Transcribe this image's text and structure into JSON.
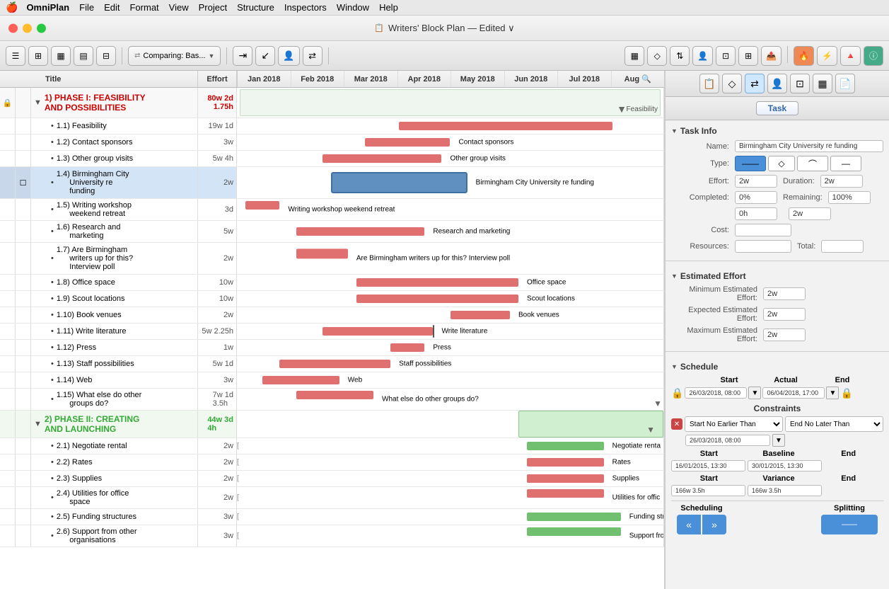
{
  "menubar": {
    "apple": "🍎",
    "items": [
      "OmniPlan",
      "File",
      "Edit",
      "Format",
      "View",
      "Project",
      "Structure",
      "Inspectors",
      "Window",
      "Help"
    ]
  },
  "titlebar": {
    "icon": "📋",
    "title": "Writers' Block Plan — Edited ∨"
  },
  "toolbar": {
    "comparing": "Comparing: Bas...",
    "buttons": [
      "≡",
      "⊞",
      "▦",
      "⊟",
      "≡",
      "↕"
    ]
  },
  "columns": {
    "title": "Title",
    "effort": "Effort",
    "months": [
      "Jan 2018",
      "Feb 2018",
      "Mar 2018",
      "Apr 2018",
      "May 2018",
      "Jun 2018",
      "Jul 2018",
      "Aug 🔍"
    ]
  },
  "tasks": [
    {
      "id": "1",
      "indent": 0,
      "phase": true,
      "label": "1)  PHASE I: FEASIBILITY AND POSSIBILITIES",
      "effort": "80w 2d\n1.75h",
      "effort_color": "red"
    },
    {
      "id": "1.1",
      "indent": 1,
      "label": "1.1)  Feasibility",
      "effort": "19w 1d"
    },
    {
      "id": "1.2",
      "indent": 1,
      "label": "1.2)  Contact sponsors",
      "effort": "3w"
    },
    {
      "id": "1.3",
      "indent": 1,
      "label": "1.3)  Other group visits",
      "effort": "5w 4h"
    },
    {
      "id": "1.4",
      "indent": 1,
      "label": "1.4)  Birmingham City University re funding",
      "effort": "2w",
      "selected": true
    },
    {
      "id": "1.5",
      "indent": 1,
      "label": "1.5)  Writing workshop weekend retreat",
      "effort": "3d"
    },
    {
      "id": "1.6",
      "indent": 1,
      "label": "1.6)  Research and marketing",
      "effort": "5w"
    },
    {
      "id": "1.7",
      "indent": 1,
      "label": "1.7)  Are Birmingham writers up for this? Interview poll",
      "effort": "2w"
    },
    {
      "id": "1.8",
      "indent": 1,
      "label": "1.8)  Office space",
      "effort": "10w"
    },
    {
      "id": "1.9",
      "indent": 1,
      "label": "1.9)  Scout locations",
      "effort": "10w"
    },
    {
      "id": "1.10",
      "indent": 1,
      "label": "1.10)  Book venues",
      "effort": "2w"
    },
    {
      "id": "1.11",
      "indent": 1,
      "label": "1.11)  Write literature",
      "effort": "5w 2.25h"
    },
    {
      "id": "1.12",
      "indent": 1,
      "label": "1.12)  Press",
      "effort": "1w"
    },
    {
      "id": "1.13",
      "indent": 1,
      "label": "1.13)  Staff possibilities",
      "effort": "5w 1d"
    },
    {
      "id": "1.14",
      "indent": 1,
      "label": "1.14)  Web",
      "effort": "3w"
    },
    {
      "id": "1.15",
      "indent": 1,
      "label": "1.15)  What else do other groups do?",
      "effort": "7w 1d\n3.5h"
    },
    {
      "id": "2",
      "indent": 0,
      "phase": true,
      "phase2": true,
      "label": "2)  PHASE II: CREATING AND LAUNCHING",
      "effort": "44w 3d\n4h",
      "effort_color": "green"
    },
    {
      "id": "2.1",
      "indent": 1,
      "label": "2.1)  Negotiate rental",
      "effort": "2w"
    },
    {
      "id": "2.2",
      "indent": 1,
      "label": "2.2)  Rates",
      "effort": "2w"
    },
    {
      "id": "2.3",
      "indent": 1,
      "label": "2.3)  Supplies",
      "effort": "2w"
    },
    {
      "id": "2.4",
      "indent": 1,
      "label": "2.4)  Utilities for office space",
      "effort": "2w"
    },
    {
      "id": "2.5",
      "indent": 1,
      "label": "2.5)  Funding structures",
      "effort": "3w"
    },
    {
      "id": "2.6",
      "indent": 1,
      "label": "2.6)  Support from other organisations",
      "effort": "3w"
    }
  ],
  "gantt_labels": {
    "feasibility": "Feasibility",
    "contact_sponsors": "Contact sponsors",
    "other_group_visits": "Other group visits",
    "bcuf": "Birmingham City University re funding",
    "writing_workshop": "Writing workshop weekend retreat",
    "research": "Research and marketing",
    "birmingham_writers": "Are Birmingham writers up for this? Interview poll",
    "office_space": "Office space",
    "scout": "Scout locations",
    "book_venues": "Book venues",
    "write_lit": "Write literature",
    "press": "Press",
    "staff": "Staff possibilities",
    "web": "Web",
    "what_else": "What else do other groups do?",
    "neg_rental": "Negotiate renta",
    "rates": "Rates",
    "supplies": "Supplies",
    "utilities": "Utilities for offic",
    "funding_str": "Funding stru",
    "support": "Support fror"
  },
  "inspector": {
    "tab_label": "Task",
    "section_task_info": "Task Info",
    "name_label": "Name:",
    "name_value": "Birmingham City University re funding",
    "type_label": "Type:",
    "effort_label": "Effort:",
    "effort_value": "2w",
    "duration_label": "Duration:",
    "duration_value": "2w",
    "completed_label": "Completed:",
    "completed_value": "0%",
    "remaining_label": "Remaining:",
    "remaining_value": "100%",
    "field_0h": "0h",
    "field_2w": "2w",
    "cost_label": "Cost:",
    "resources_label": "Resources:",
    "total_label": "Total:",
    "section_estimated": "Estimated Effort",
    "min_effort_label": "Minimum Estimated Effort:",
    "min_effort_value": "2w",
    "expected_effort_label": "Expected Estimated Effort:",
    "expected_effort_value": "2w",
    "max_effort_label": "Maximum Estimated Effort:",
    "max_effort_value": "2w",
    "section_schedule": "Schedule",
    "col_start": "Start",
    "col_actual": "Actual",
    "col_end": "End",
    "start_date": "26/03/2018, 08:00",
    "actual_date": "06/04/2018, 17:00",
    "end_date_empty": "",
    "constraints_label": "Constraints",
    "constraint_start": "Start No Earlier Than",
    "constraint_end": "End No Later Than",
    "constraint_date": "26/03/2018, 08:00",
    "col_baseline": "Baseline",
    "baseline_start": "16/01/2015, 13:30",
    "baseline_end": "30/01/2015, 13:30",
    "col_variance": "Variance",
    "variance_start": "166w 3.5h",
    "variance_end": "166w 3.5h",
    "scheduling_label": "Scheduling",
    "splitting_label": "Splitting"
  }
}
